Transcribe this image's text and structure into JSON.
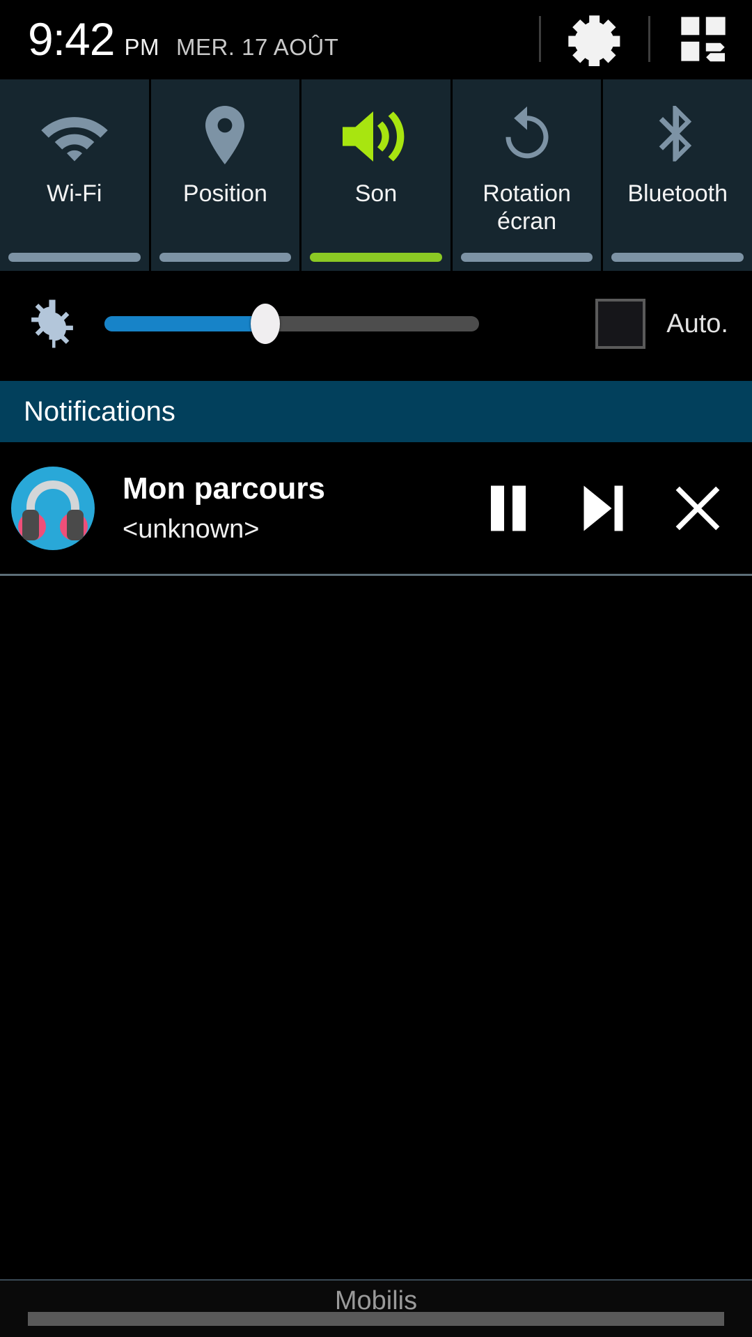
{
  "statusbar": {
    "time": "9:42",
    "ampm": "PM",
    "date": "MER. 17 AOÛT",
    "settings_icon": "gear-icon",
    "edit_icon": "quick-settings-edit-icon"
  },
  "quick_settings": {
    "tiles": [
      {
        "label": "Wi-Fi",
        "icon": "wifi-icon",
        "active": false
      },
      {
        "label": "Position",
        "icon": "location-pin-icon",
        "active": false
      },
      {
        "label": "Son",
        "icon": "sound-volume-icon",
        "active": true
      },
      {
        "label": "Rotation écran",
        "icon": "screen-rotation-icon",
        "active": false
      },
      {
        "label": "Bluetooth",
        "icon": "bluetooth-icon",
        "active": false
      }
    ]
  },
  "brightness": {
    "icon": "brightness-icon",
    "value_percent": 43,
    "auto_label": "Auto.",
    "auto_checked": false,
    "fill_color": "#1783c8",
    "track_color": "#4d4d4d"
  },
  "notifications": {
    "header_title": "Notifications",
    "items": [
      {
        "icon": "headphones-music-icon",
        "title": "Mon parcours",
        "subtitle": "<unknown>",
        "actions": [
          {
            "name": "pause-button",
            "label": "Pause"
          },
          {
            "name": "next-track-button",
            "label": "Suivant"
          },
          {
            "name": "close-notification-button",
            "label": "Fermer"
          }
        ]
      }
    ]
  },
  "footer": {
    "carrier": "Mobilis"
  },
  "colors": {
    "tile_bg": "#16262f",
    "tile_indicator_off": "#7d93a5",
    "tile_indicator_on": "#8bc924",
    "accent_green": "#a8e510",
    "notif_header_bg": "#02405c",
    "icon_inactive": "#7d93a5"
  }
}
